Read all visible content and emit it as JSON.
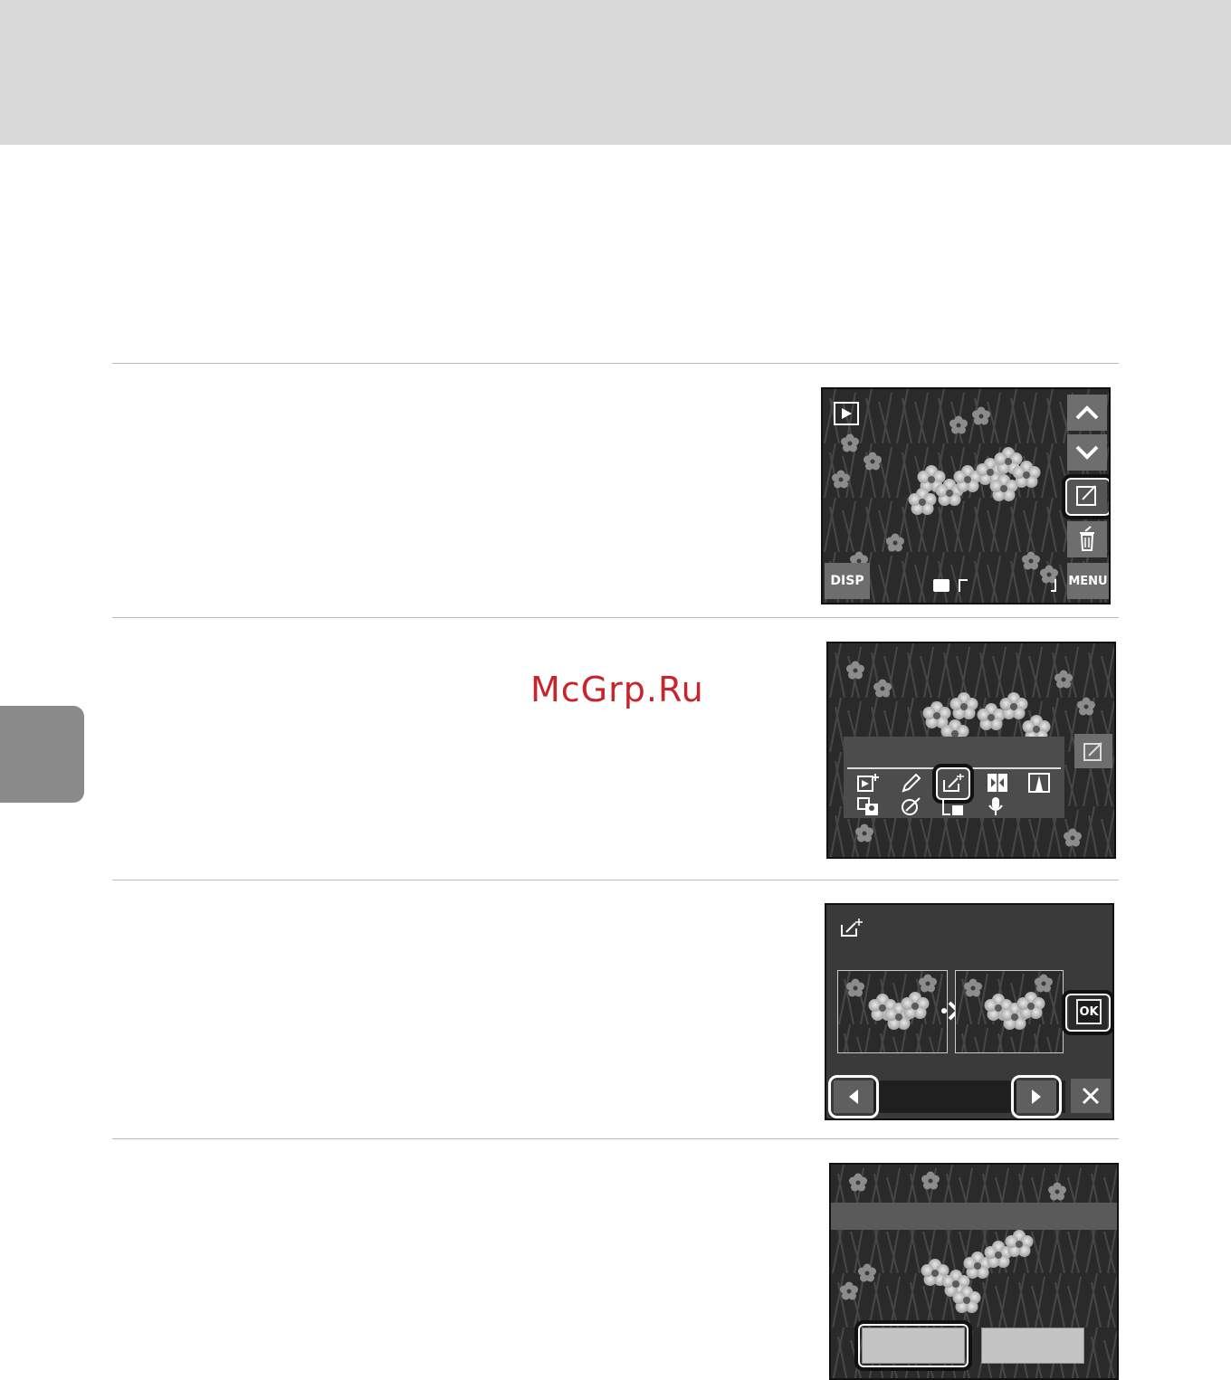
{
  "header": {
    "background": "#dadada"
  },
  "watermark": {
    "text": "McGrp.Ru",
    "color": "#c8242b"
  },
  "screens": {
    "playback": {
      "disp_label": "DISP",
      "menu_label": "MENU",
      "status_icons": [
        "image-size-10m-icon",
        "internal-memory-icon"
      ],
      "buttons": [
        "scroll-up-icon",
        "scroll-down-icon",
        "edit-icon",
        "delete-icon"
      ]
    },
    "edit_menu": {
      "icons_row1": [
        "d-lighting-icon",
        "paint-icon",
        "quick-retouch-icon",
        "crop-icon",
        "black-border-icon"
      ],
      "icons_row2": [
        "skin-softening-icon",
        "filter-effects-icon",
        "small-picture-icon",
        "voice-memo-icon"
      ],
      "selected": "quick-retouch-icon"
    },
    "retouch": {
      "mode_icon": "quick-retouch-icon",
      "ok_label": "OK",
      "buttons": [
        "previous-arrow-icon",
        "next-arrow-icon",
        "close-icon"
      ]
    },
    "confirm": {
      "buttons": [
        "confirm-left-button",
        "confirm-right-button"
      ]
    }
  }
}
